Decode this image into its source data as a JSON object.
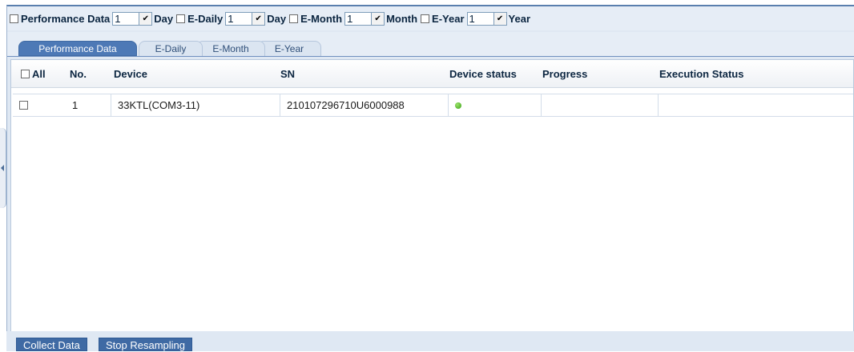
{
  "filters": [
    {
      "label": "Performance Data",
      "value": "1",
      "unit": "Day"
    },
    {
      "label": "E-Daily",
      "value": "1",
      "unit": "Day"
    },
    {
      "label": "E-Month",
      "value": "1",
      "unit": "Month"
    },
    {
      "label": "E-Year",
      "value": "1",
      "unit": "Year"
    }
  ],
  "tabs": [
    "Performance Data",
    "E-Daily",
    "E-Month",
    "E-Year"
  ],
  "table": {
    "columns": [
      "All",
      "No.",
      "Device",
      "SN",
      "Device status",
      "Progress",
      "Execution Status"
    ],
    "rows": [
      {
        "no": "1",
        "device": "33KTL(COM3-11)",
        "sn": "210107296710U6000988",
        "status": "online",
        "progress": "",
        "execution_status": ""
      }
    ]
  },
  "buttons": {
    "collect": "Collect Data",
    "stop": "Stop Resampling"
  },
  "colors": {
    "accent": "#3f6aa4",
    "status_online": "#3aa115"
  }
}
